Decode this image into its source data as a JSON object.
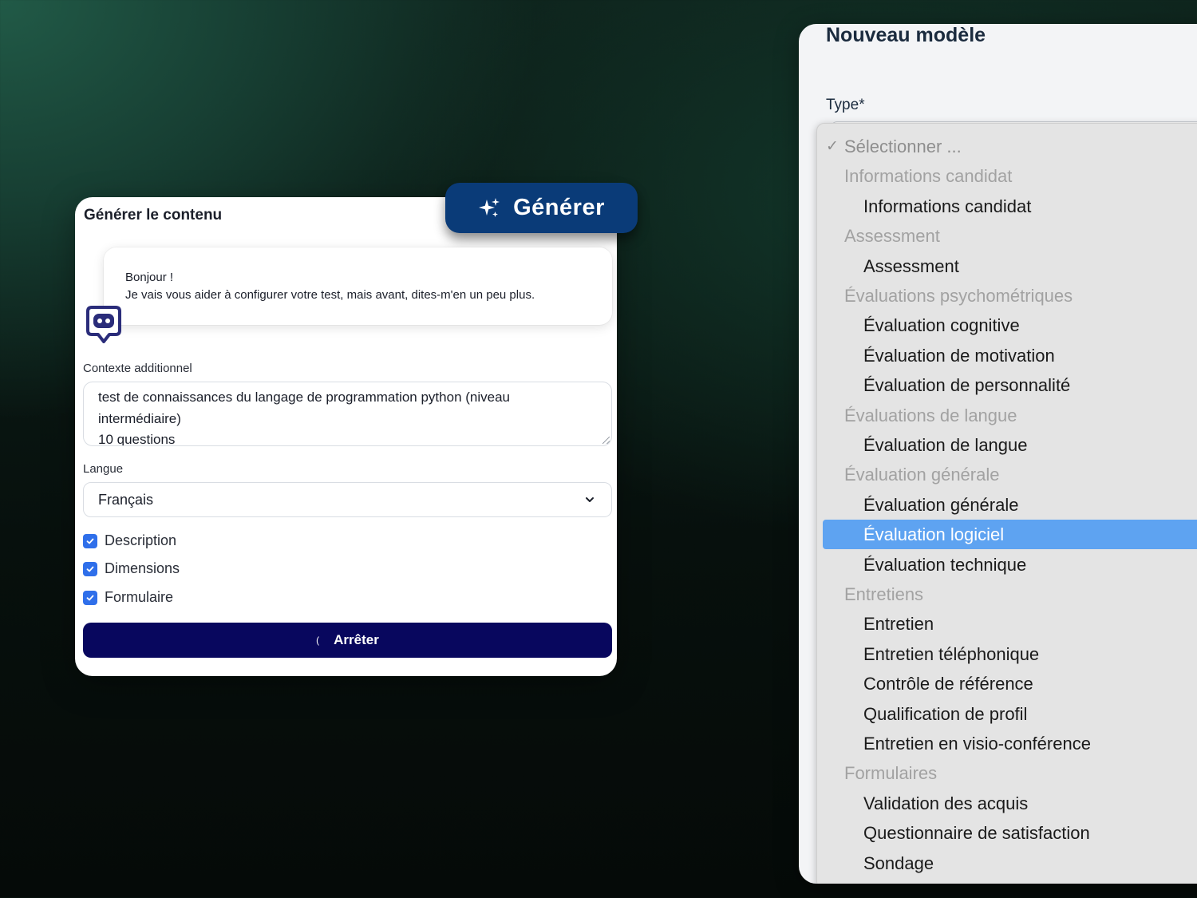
{
  "generator": {
    "title": "Générer le contenu",
    "generate_button": "Générer",
    "bubble_line1": "Bonjour !",
    "bubble_line2": "Je vais vous aider à configurer votre test, mais avant, dites-m'en un peu plus.",
    "context_label": "Contexte additionnel",
    "context_value_line1": "test de connaissances du langage de programmation python (niveau",
    "context_value_line2": "intermédiaire)",
    "context_value_line3": "10 questions",
    "language_label": "Langue",
    "language_value": "Français",
    "checkboxes": [
      {
        "label": "Description",
        "checked": true
      },
      {
        "label": "Dimensions",
        "checked": true
      },
      {
        "label": "Formulaire",
        "checked": true
      }
    ],
    "stop_button": "Arrêter",
    "stop_spinner": "(",
    "accent_color": "#0a3b78",
    "stop_color": "#08075e",
    "checkbox_color": "#2f6fea"
  },
  "model_panel": {
    "title": "Nouveau modèle",
    "type_label": "Type*",
    "dropdown": {
      "placeholder": "Sélectionner ...",
      "placeholder_tick": "✓",
      "selected": "Évaluation logiciel",
      "highlight_color": "#5ea3f1",
      "groups": [
        {
          "label": "Informations candidat",
          "options": [
            "Informations candidat"
          ]
        },
        {
          "label": "Assessment",
          "options": [
            "Assessment"
          ]
        },
        {
          "label": "Évaluations psychométriques",
          "options": [
            "Évaluation cognitive",
            "Évaluation de motivation",
            "Évaluation de personnalité"
          ]
        },
        {
          "label": "Évaluations de langue",
          "options": [
            "Évaluation de langue"
          ]
        },
        {
          "label": "Évaluation générale",
          "options": [
            "Évaluation générale",
            "Évaluation logiciel",
            "Évaluation technique"
          ]
        },
        {
          "label": "Entretiens",
          "options": [
            "Entretien",
            "Entretien téléphonique",
            "Contrôle de référence",
            "Qualification de profil",
            "Entretien en visio-conférence"
          ]
        },
        {
          "label": "Formulaires",
          "options": [
            "Validation des acquis",
            "Questionnaire de satisfaction",
            "Sondage"
          ]
        }
      ]
    }
  }
}
